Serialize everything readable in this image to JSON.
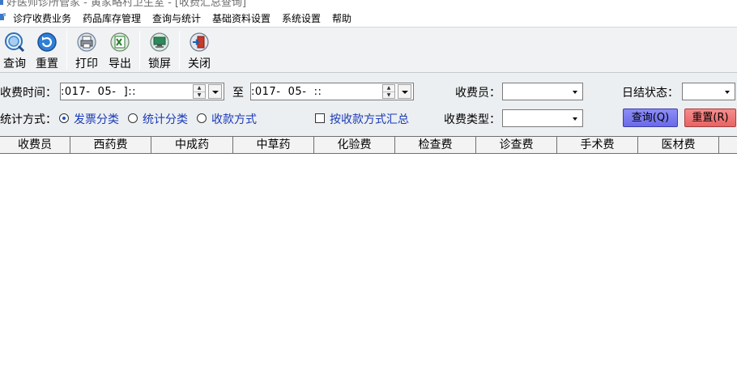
{
  "window": {
    "title": "好医师诊所管家 - 黄家略村卫生室 - [收费汇总查询]"
  },
  "menu": {
    "items": [
      "诊疗收费业务",
      "药品库存管理",
      "查询与统计",
      "基础资料设置",
      "系统设置",
      "帮助"
    ]
  },
  "toolbar": {
    "buttons": [
      {
        "label": "查询",
        "icon": "search-icon"
      },
      {
        "label": "重置",
        "icon": "refresh-icon"
      },
      {
        "label": "打印",
        "icon": "printer-icon"
      },
      {
        "label": "导出",
        "icon": "excel-export-icon"
      },
      {
        "label": "锁屏",
        "icon": "monitor-lock-icon"
      },
      {
        "label": "关闭",
        "icon": "exit-door-icon"
      }
    ]
  },
  "filters": {
    "time_label": "收费时间：",
    "date_from": ":017-  05-  ]::",
    "to_label": "至",
    "date_to": ":017-  05-  ::",
    "cashier_label": "收费员：",
    "cashier_value": "",
    "daily_status_label": "日结状态：",
    "daily_status_value": "",
    "stat_mode_label": "统计方式：",
    "radio_options": [
      {
        "label": "发票分类",
        "checked": true
      },
      {
        "label": "统计分类",
        "checked": false
      },
      {
        "label": "收款方式",
        "checked": false
      }
    ],
    "summary_checkbox_label": "按收款方式汇总",
    "summary_checked": false,
    "fee_type_label": "收费类型：",
    "fee_type_value": "",
    "query_button": "查询(Q)",
    "reset_button": "重置(R)"
  },
  "grid": {
    "columns": [
      "收费员",
      "西药费",
      "中成药",
      "中草药",
      "化验费",
      "检查费",
      "诊查费",
      "手术费",
      "医材费"
    ],
    "rows": []
  },
  "colors": {
    "query_button": "#7b7bef",
    "reset_button": "#ee7373",
    "radio_text": "#1a3ab8",
    "filter_background": "#eceff1"
  }
}
